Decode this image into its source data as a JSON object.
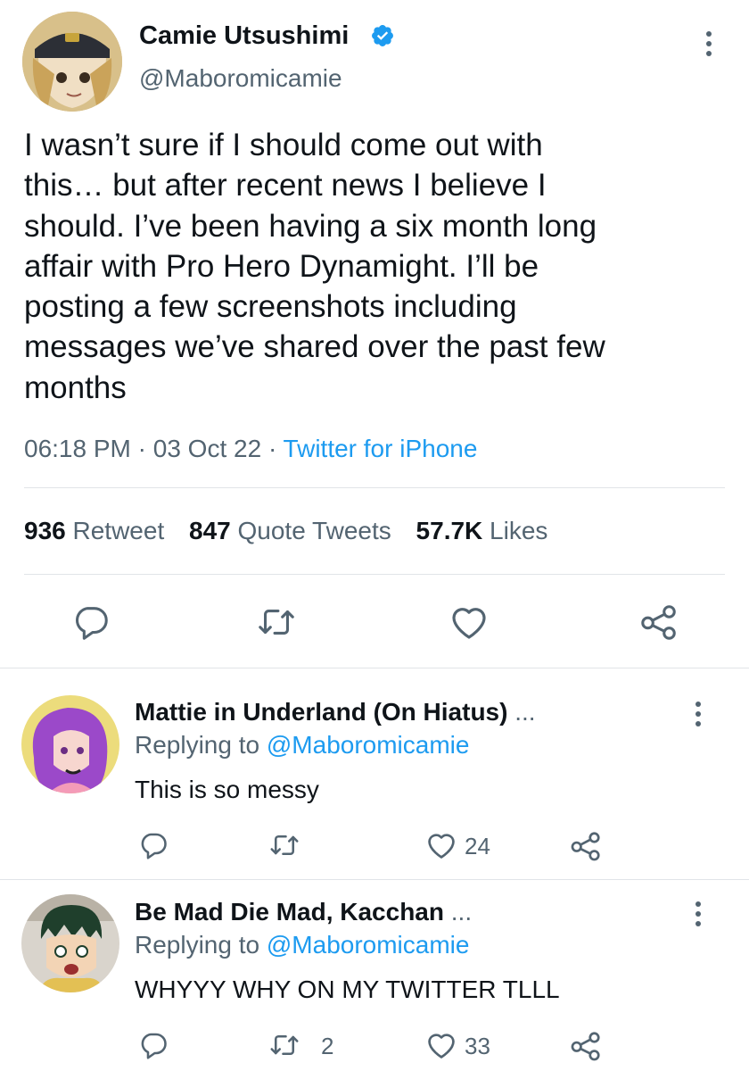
{
  "tweet": {
    "author_name": "Camie Utsushimi",
    "author_handle": "@Maboromicamie",
    "text_lines": [
      "I wasn’t sure if I should come out with",
      "this… but after recent news I believe I",
      "should. I’ve been having a six month long",
      "affair with Pro Hero Dynamight. I’ll be",
      "posting a few screenshots including",
      "messages we’ve shared over the past few",
      "months"
    ],
    "time": "06:18 PM",
    "sep": "·",
    "date": "03 Oct 22",
    "source": "Twitter for iPhone",
    "retweet_count": "936",
    "retweet_label": "Retweet",
    "quote_count": "847",
    "quote_label": "Quote Tweets",
    "likes_count": "57.7K",
    "likes_label": "Likes"
  },
  "replies": [
    {
      "name": "Mattie in Underland (On Hiatus)",
      "ellipsis": "...",
      "replying_prefix": "Replying to",
      "replying_handle": "@Maboromicamie",
      "text": "This is so messy",
      "retweets": "",
      "likes": "24"
    },
    {
      "name": "Be Mad Die Mad, Kacchan",
      "ellipsis": "...",
      "replying_prefix": "Replying to",
      "replying_handle": "@Maboromicamie",
      "text": "WHYYY WHY ON MY TWITTER TLLL",
      "retweets": "2",
      "likes": "33"
    }
  ],
  "colors": {
    "accent": "#1d9bf0",
    "verified": "#1d9bf0",
    "muted": "#536471"
  },
  "icons": [
    "verified-badge-icon",
    "more-icon",
    "reply-icon",
    "retweet-icon",
    "like-icon",
    "share-icon"
  ]
}
